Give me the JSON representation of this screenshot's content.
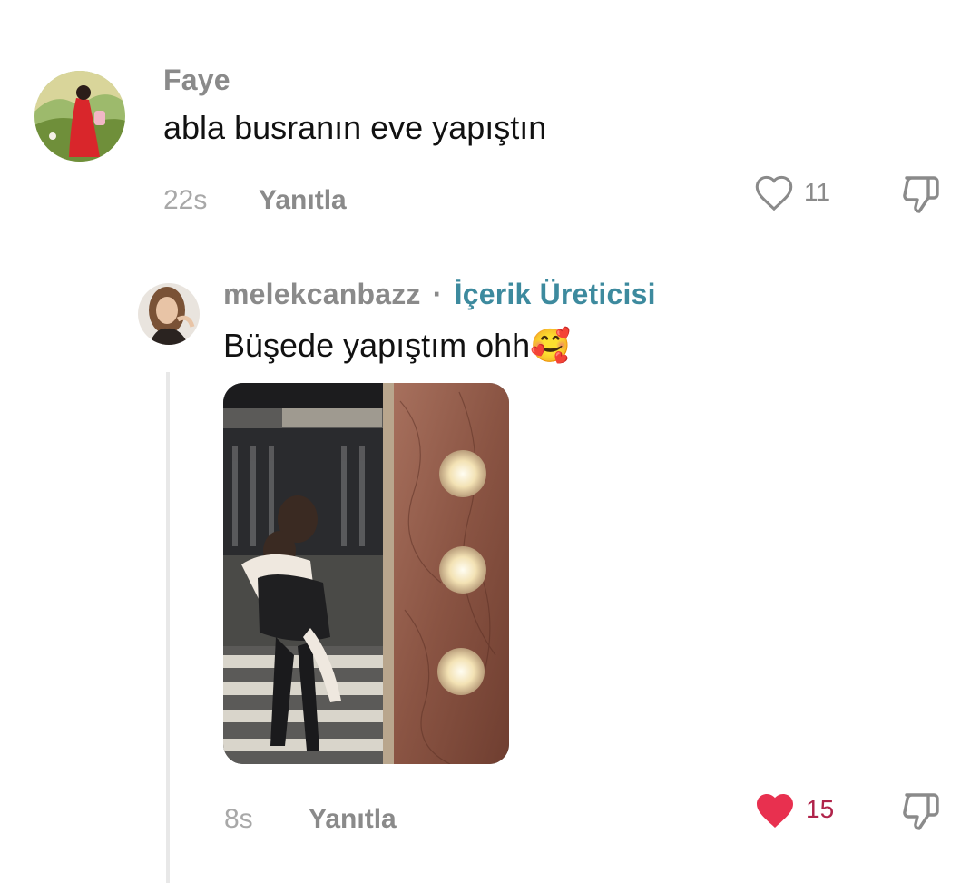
{
  "comment1": {
    "username": "Faye",
    "text": "abla busranın eve yapıştın",
    "time": "22s",
    "reply_label": "Yanıtla",
    "like_count": "11",
    "liked": false
  },
  "comment2": {
    "username": "melekcanbazz",
    "separator": "·",
    "badge": "İçerik Üreticisi",
    "text": "Büşede yapıştım ohh",
    "emoji": "🥰",
    "time": "8s",
    "reply_label": "Yanıtla",
    "like_count": "15",
    "liked": true
  },
  "colors": {
    "liked": "#e8304f",
    "like_count_liked": "#b0234a",
    "creator_badge": "#3d8a9e"
  }
}
